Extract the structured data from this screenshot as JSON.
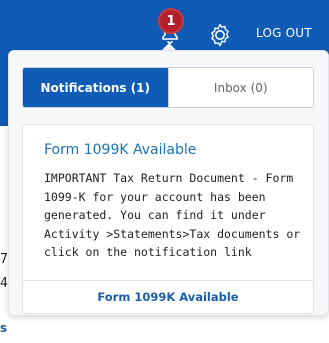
{
  "header": {
    "notification_count": "1",
    "logout_label": "LOG OUT"
  },
  "tabs": [
    {
      "label": "Notifications (1)",
      "active": true
    },
    {
      "label": "Inbox (0)",
      "active": false
    }
  ],
  "notification": {
    "title": "Form 1099K Available",
    "body": "IMPORTANT Tax Return Document - Form 1099-K for your account has been generated. You can find it under Activity >Statements>Tax documents or click on the notification link",
    "link_label": "Form 1099K Available"
  },
  "page_fragments": {
    "char_a": "7",
    "char_b": "4",
    "char_c": "s"
  },
  "colors": {
    "brand_blue": "#0f5bb6",
    "badge_red": "#b3202a",
    "link_blue": "#1a73b8"
  },
  "icons": [
    "bell-icon",
    "gear-icon"
  ]
}
